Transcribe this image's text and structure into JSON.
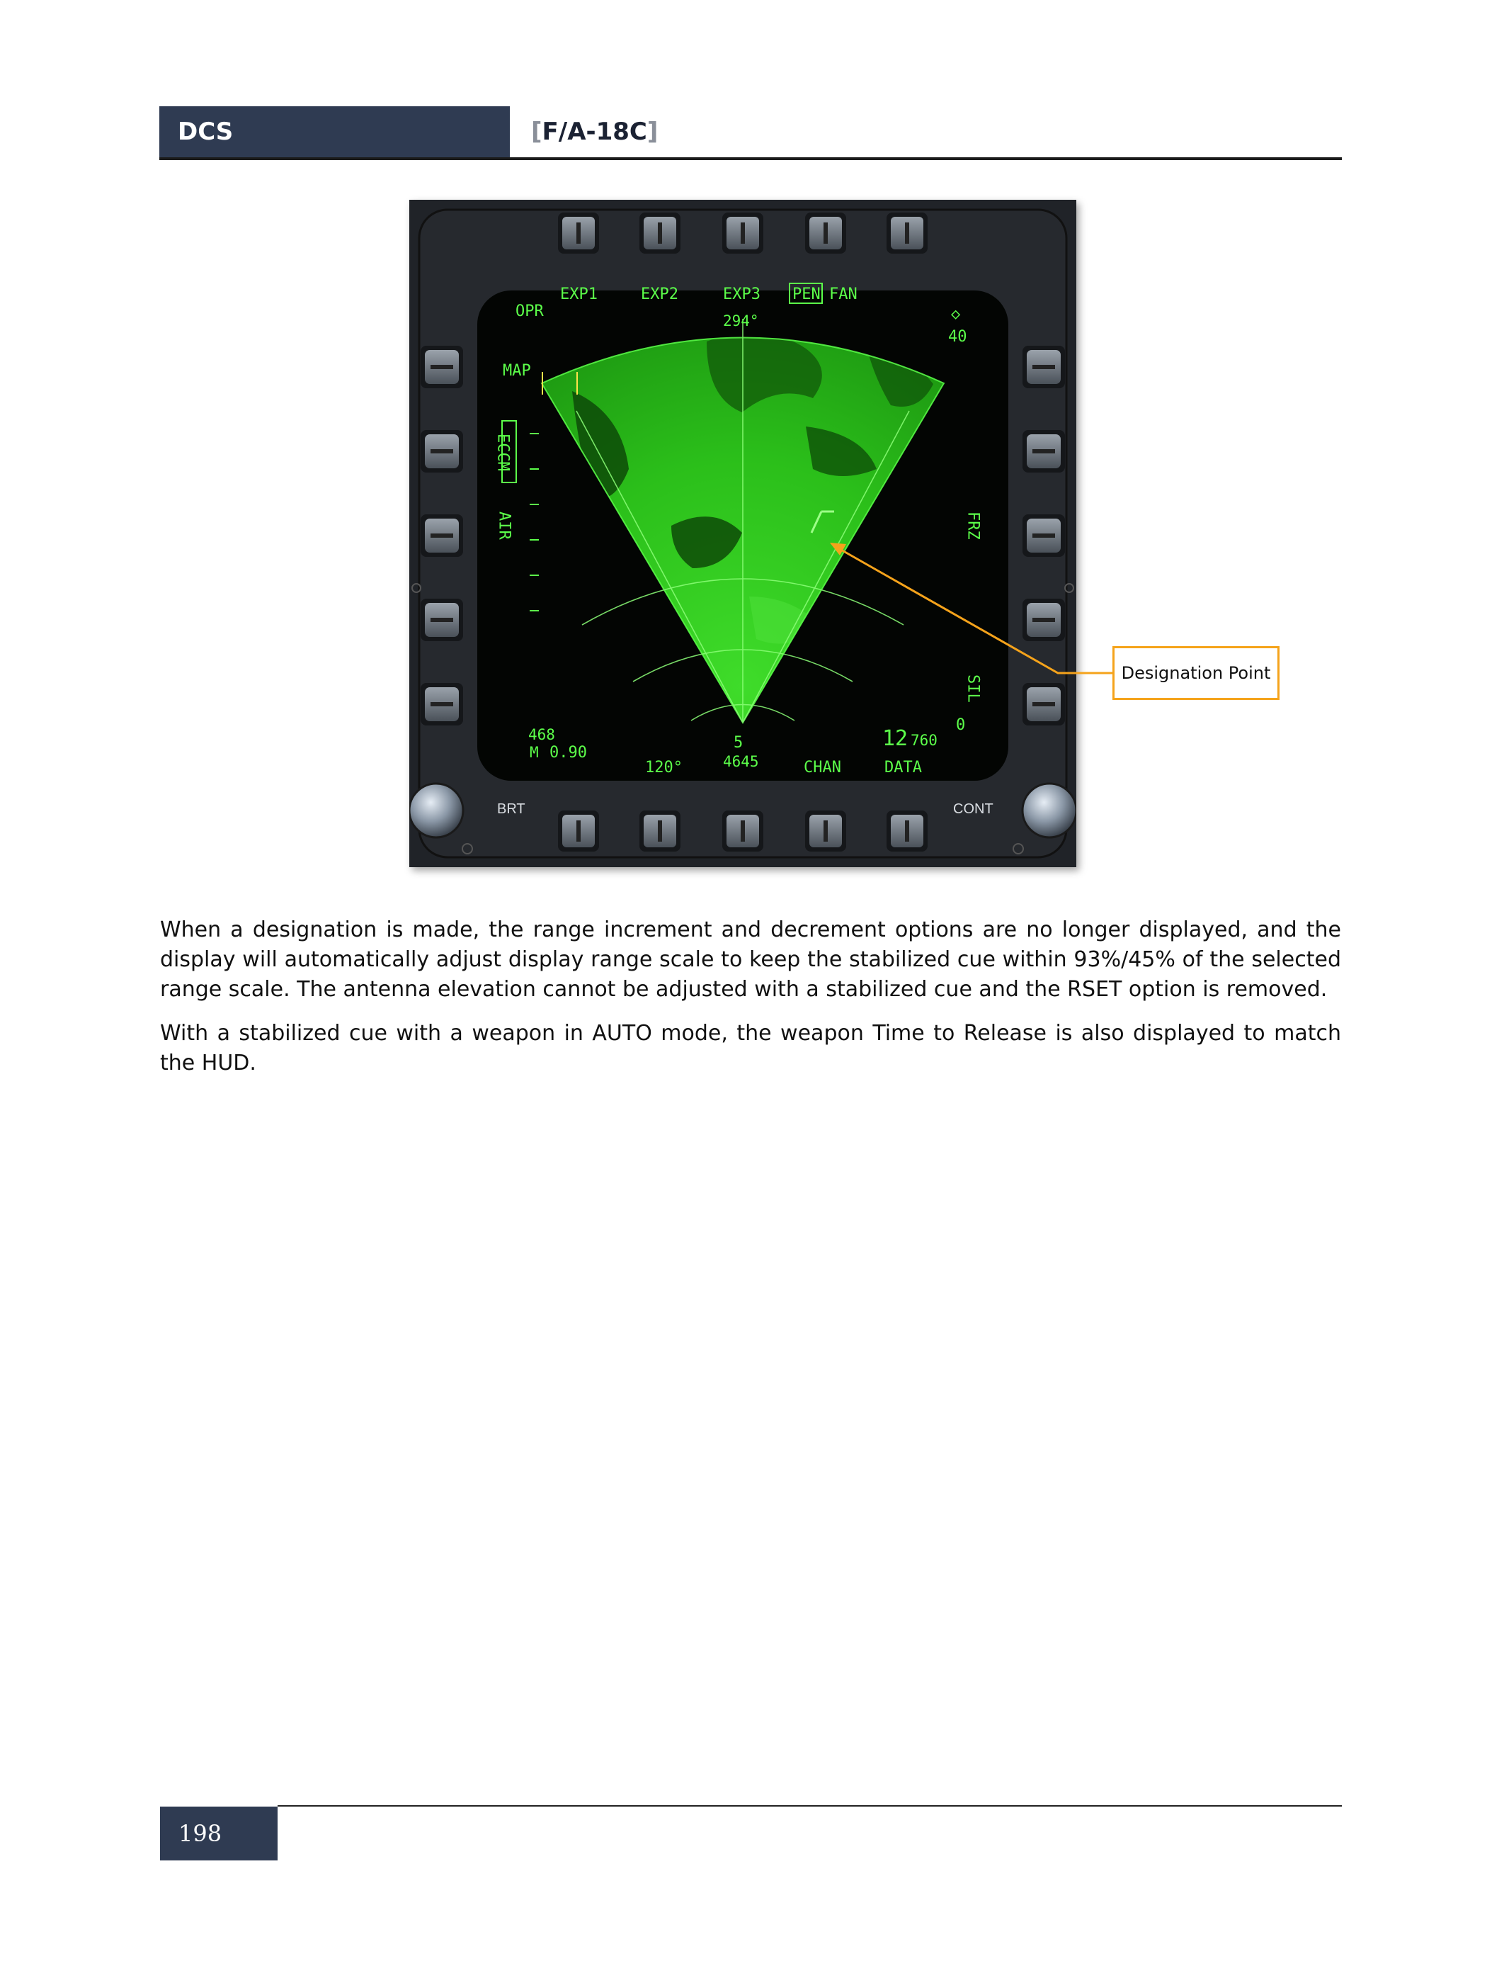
{
  "header": {
    "left": "DCS",
    "right_open": "[",
    "right_title": "F/A-18C",
    "right_close": "]"
  },
  "figure": {
    "top_options": [
      "EXP1",
      "EXP2",
      "EXP3",
      "PEN",
      "FAN"
    ],
    "heading": "294°",
    "opr": "OPR",
    "range_symbol": "◇",
    "range_value": "40",
    "left_options": [
      "MAP",
      "ECCM",
      "AIR"
    ],
    "right_options": [
      "FRZ",
      "SIL"
    ],
    "sil_value": "0",
    "speed_top": "468",
    "speed_label": "M",
    "mach": "0.90",
    "azimuth": "120°",
    "time_to_release": "5",
    "range_readout": "4645",
    "chan": "CHAN",
    "altitude_big": "12",
    "altitude_small": "760",
    "data": "DATA",
    "brt": "BRT",
    "cont": "CONT",
    "colors": {
      "symbology": "#5cff4a",
      "radar": "#2fc61e",
      "callout": "#f5a31b"
    }
  },
  "callout_label": "Designation Point",
  "paragraphs": [
    "When a designation is made, the range increment and decrement options are no longer displayed, and the display will automatically adjust display range scale to keep the stabilized cue within 93%/45% of the selected range scale. The antenna elevation cannot be adjusted with a stabilized cue and the RSET option is removed.",
    "With a stabilized cue with a weapon in AUTO mode, the weapon Time to Release is also displayed to match the HUD."
  ],
  "footer": {
    "page_number": "198"
  }
}
